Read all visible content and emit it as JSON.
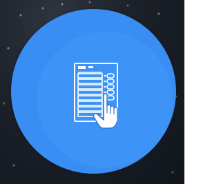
{
  "app": {
    "icon": "evm-ballot-unit-icon",
    "colors": {
      "tile_outer": "#3a8ef3",
      "tile_inner": "#3e93f7",
      "icon_stroke": "#ffffff"
    }
  }
}
